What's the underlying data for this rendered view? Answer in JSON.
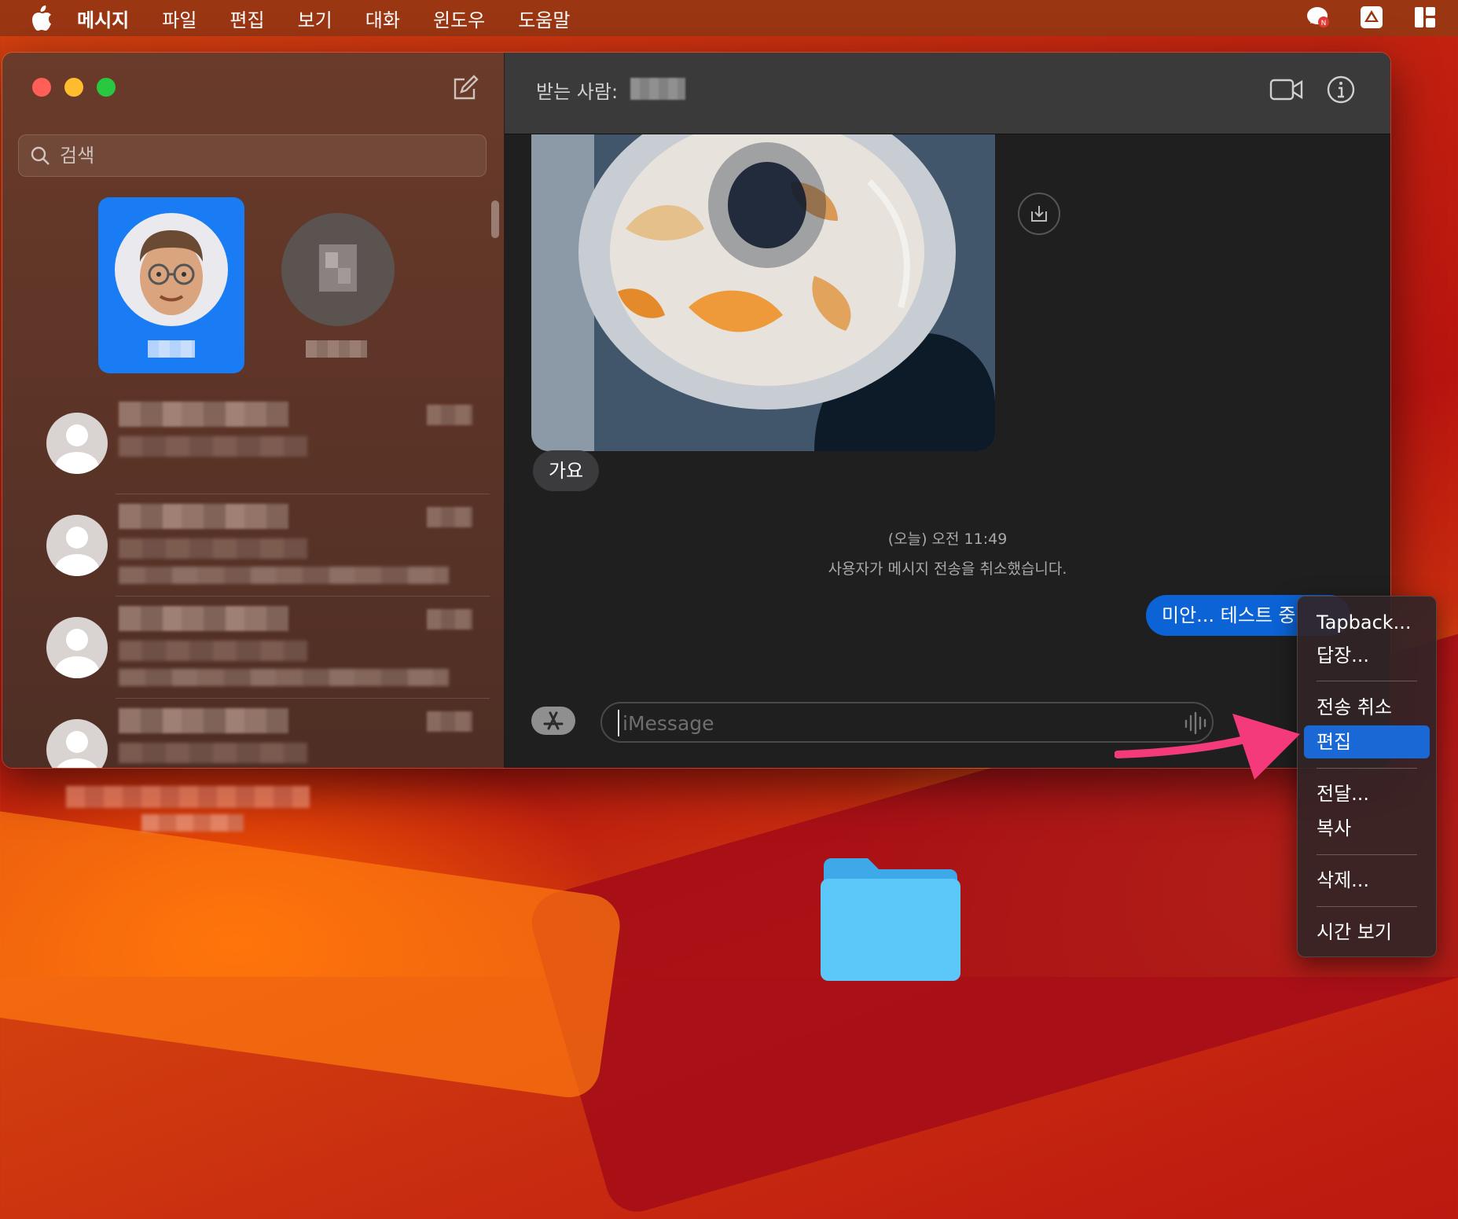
{
  "menubar": {
    "items": [
      "메시지",
      "파일",
      "편집",
      "보기",
      "대화",
      "윈도우",
      "도움말"
    ],
    "tray_icons": [
      "messenger-icon",
      "drive-icon",
      "window-layout-icon"
    ]
  },
  "sidebar": {
    "search_placeholder": "검색",
    "pinned": [
      {
        "selected": true,
        "avatar": "memoji-avatar"
      },
      {
        "selected": false,
        "avatar": "blurred-avatar"
      }
    ],
    "conversation_count": 4
  },
  "chat": {
    "to_label": "받는 사람:",
    "incoming_message": "가요",
    "timestamp": "(오늘) 오전 11:49",
    "unsend_notice": "사용자가 메시지 전송을 취소했습니다.",
    "outgoing_message": "미안... 테스트 중",
    "input_placeholder": "iMessage"
  },
  "context_menu": {
    "items": {
      "tapback": "Tapback...",
      "reply": "답장...",
      "undo_send": "전송 취소",
      "edit": "편집",
      "forward": "전달...",
      "copy": "복사",
      "delete": "삭제...",
      "show_time": "시간 보기"
    },
    "highlighted": "edit"
  },
  "colors": {
    "accent": "#1a68d6",
    "outgoing_bubble": "#0b63d6",
    "annotation_arrow": "#f43a7a",
    "close": "#ff5f57",
    "minimize": "#febc2e",
    "zoom": "#28c840"
  }
}
